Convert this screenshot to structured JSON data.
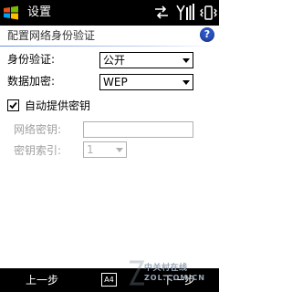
{
  "titlebar": {
    "app_title": "设置",
    "start_icon": "windows-flag-icon",
    "status_icons": [
      "connectivity-arrows-icon",
      "signal-strength-icon",
      "vibrate-mode-icon"
    ]
  },
  "page": {
    "title": "配置网络身份验证",
    "help_icon": "help-icon",
    "help_label": "?"
  },
  "form": {
    "auth_label": "身份验证:",
    "auth_value": "公开",
    "encryption_label": "数据加密:",
    "encryption_value": "WEP",
    "auto_key_label": "自动提供密钥",
    "auto_key_checked": true,
    "network_key_label": "网络密钥:",
    "network_key_value": "",
    "key_index_label": "密钥索引:",
    "key_index_value": "1"
  },
  "softkeys": {
    "left": "上一步",
    "right": "下一步",
    "input_icon": "keyboard-input-icon",
    "input_label": "A4"
  },
  "watermark": {
    "line1": "中关村在线",
    "line2": "ZOL.COM.CN"
  },
  "colors": {
    "titlebar_bg": "#000000",
    "accent": "#2a53c3",
    "disabled_text": "#a0a0a0"
  }
}
